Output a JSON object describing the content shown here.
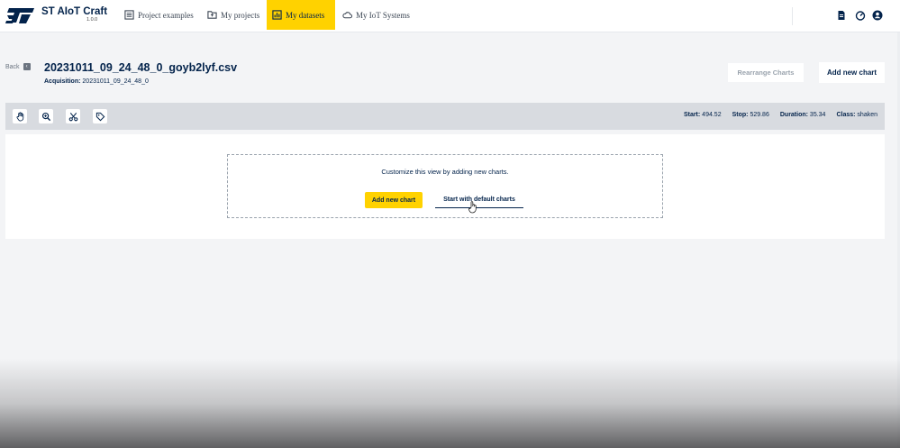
{
  "app": {
    "brand": "ST AIoT Craft",
    "version": "1.0.0"
  },
  "nav": {
    "items": [
      {
        "label": "Project examples",
        "icon": "list-icon",
        "active": false
      },
      {
        "label": "My projects",
        "icon": "folder-icon",
        "active": false
      },
      {
        "label": "My datasets",
        "icon": "chart-icon",
        "active": true
      },
      {
        "label": "My IoT Systems",
        "icon": "cloud-icon",
        "active": false
      }
    ],
    "right_icons": [
      "document-icon",
      "dashboard-icon",
      "user-icon"
    ]
  },
  "header": {
    "back_label": "Back",
    "file_name": "20231011_09_24_48_0_goyb2lyf.csv",
    "acquisition_label": "Acquisition:",
    "acquisition_value": "20231011_09_24_48_0",
    "rearrange_label": "Rearrange Charts",
    "add_chart_label": "Add new chart"
  },
  "toolbar": {
    "tools": [
      "hand-icon",
      "zoom-icon",
      "scissors-icon",
      "tag-icon"
    ],
    "start_label": "Start:",
    "start_value": "494.52",
    "stop_label": "Stop:",
    "stop_value": "529.86",
    "duration_label": "Duration:",
    "duration_value": "35.34",
    "class_label": "Class:",
    "class_value": "shaken"
  },
  "empty_state": {
    "message": "Customize this view by adding new charts.",
    "add_chart_label": "Add new chart",
    "default_charts_label": "Start with default charts"
  },
  "colors": {
    "accent": "#ffd200",
    "brand_navy": "#03234b",
    "toolbar_bg": "#d8dbe0"
  }
}
